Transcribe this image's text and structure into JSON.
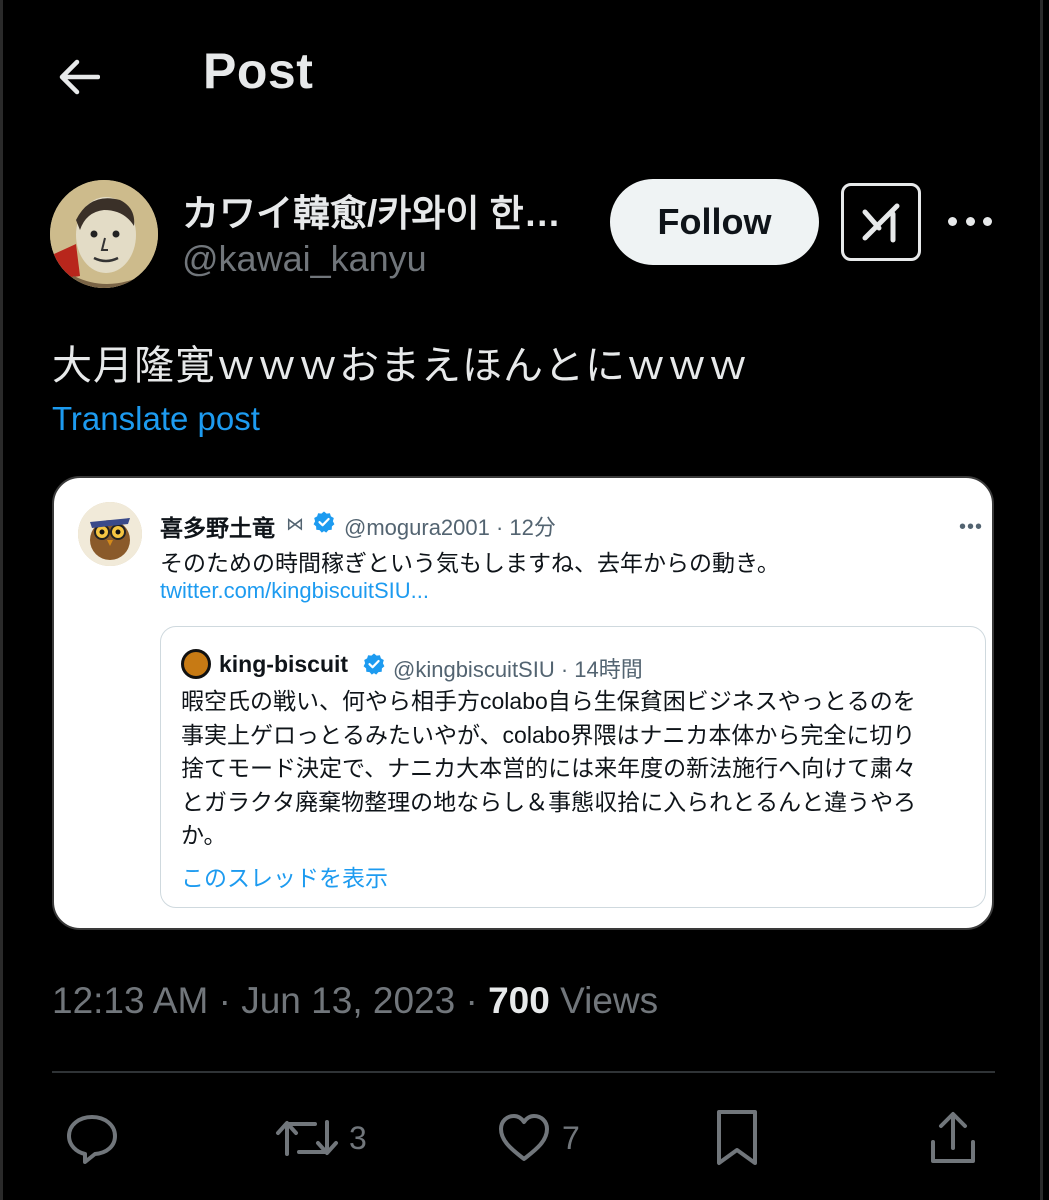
{
  "header": {
    "title": "Post"
  },
  "author": {
    "display_name": "カワイ韓愈/카와이 한…",
    "handle": "@kawai_kanyu",
    "follow_label": "Follow"
  },
  "post": {
    "text": "大月隆寛ｗｗｗおまえほんとにｗｗｗ",
    "translate_label": "Translate post"
  },
  "embedded": {
    "name": "喜多野土竜",
    "bowtie": "⋈",
    "meta": "@mogura2001 · 12分",
    "more": "•••",
    "text": "そのための時間稼ぎという気もしますね、去年からの動き。",
    "link": "twitter.com/kingbiscuitSIU...",
    "quote": {
      "name": "king-biscuit",
      "meta": "@kingbiscuitSIU · 14時間",
      "lines": [
        "暇空氏の戦い、何やら相手方colabo自ら生保貧困ビジネスやっとるのを",
        "事実上ゲロっとるみたいやが、colabo界隈はナニカ本体から完全に切り",
        "捨てモード決定で、ナニカ大本営的には来年度の新法施行へ向けて粛々",
        "とガラクタ廃棄物整理の地ならし＆事態収拾に入られとるんと違うやろ",
        "か。"
      ],
      "thread_label": "このスレッドを表示"
    }
  },
  "timestamp": {
    "time": "12:13 AM",
    "sep1": " · ",
    "date": "Jun 13, 2023",
    "sep2": " · ",
    "views_count": "700",
    "views_label": " Views"
  },
  "actions": {
    "reply_count": "",
    "repost_count": "3",
    "like_count": "7"
  },
  "colors": {
    "background": "#000000",
    "text": "#e7e9ea",
    "muted": "#71767b",
    "link": "#1d9bf0",
    "follow_bg": "#eff3f4"
  },
  "icons": [
    "back-arrow-icon",
    "grok-icon",
    "more-icon",
    "verified-icon",
    "reply-icon",
    "repost-icon",
    "like-icon",
    "bookmark-icon",
    "share-icon"
  ]
}
